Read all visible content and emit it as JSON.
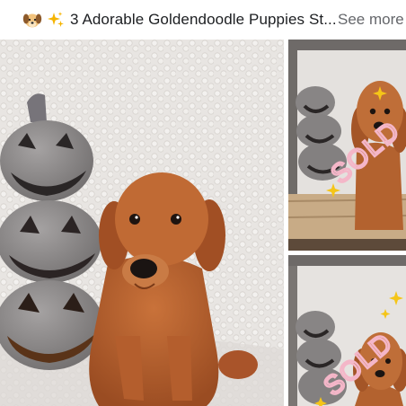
{
  "post": {
    "title": "3 Adorable Goldendoodle Puppies St...",
    "see_more_label": "See more",
    "title_icons": [
      "dog-face-icon",
      "sparkles-icon"
    ]
  },
  "photos": [
    {
      "name": "main-puppy-photo",
      "overlay_text": ""
    },
    {
      "name": "sold-puppy-photo-1",
      "overlay_text": "SOLD"
    },
    {
      "name": "sold-puppy-photo-2",
      "overlay_text": "SOLD"
    }
  ],
  "colors": {
    "title_text": "#1c1e21",
    "see_more_text": "#65676b",
    "sold_text": "#f4b6c8",
    "puppy_fur": "#b8622c",
    "pumpkin_gray": "#8f8c8c",
    "blanket": "#e9e6e3"
  }
}
